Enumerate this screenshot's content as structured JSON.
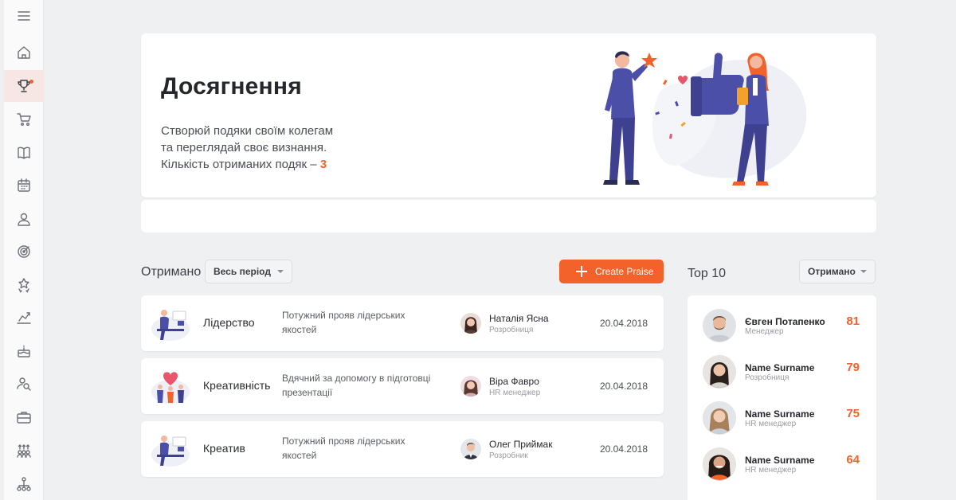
{
  "hero": {
    "title": "Досягнення",
    "line1": "Створюй подяки своїм колегам",
    "line2": "та переглядай своє визнання.",
    "line3_prefix": "Кількість отриманих подяк – ",
    "count": "3"
  },
  "received": {
    "label": "Отримано",
    "period_select": "Весь період",
    "create_button": "Create Praise"
  },
  "praises": [
    {
      "category": "Лідерство",
      "description": "Потужний прояв лідерських якостей",
      "person": "Наталія Ясна",
      "role": "Розробниця",
      "date": "20.04.2018"
    },
    {
      "category": "Креативність",
      "description": "Вдячний за допомогу в підготовці презентації",
      "person": "Віра Фавро",
      "role": "HR менеджер",
      "date": "20.04.2018"
    },
    {
      "category": "Креатив",
      "description": "Потужний прояв лідерських якостей",
      "person": "Олег Приймак",
      "role": "Розробник",
      "date": "20.04.2018"
    }
  ],
  "top": {
    "label": "Top 10",
    "select": "Отримано",
    "rows": [
      {
        "name": "Євген Потапенко",
        "role": "Менеджер",
        "score": "81"
      },
      {
        "name": "Name Surname",
        "role": "Розробниця",
        "score": "79"
      },
      {
        "name": "Name Surname",
        "role": "HR менеджер",
        "score": "75"
      },
      {
        "name": "Name Surname",
        "role": "HR менеджер",
        "score": "64"
      }
    ]
  },
  "sidebar": {
    "items": [
      "menu-icon",
      "home-icon",
      "trophy-icon",
      "cart-icon",
      "book-icon",
      "calendar-icon",
      "user-icon",
      "target-icon",
      "stars-icon",
      "chart-icon",
      "cake-icon",
      "search-people-icon",
      "briefcase-icon",
      "team-icon",
      "org-chart-icon"
    ]
  },
  "colors": {
    "accent": "#f4622c",
    "background": "#eff0f2",
    "indigo": "#4b4fa8"
  }
}
